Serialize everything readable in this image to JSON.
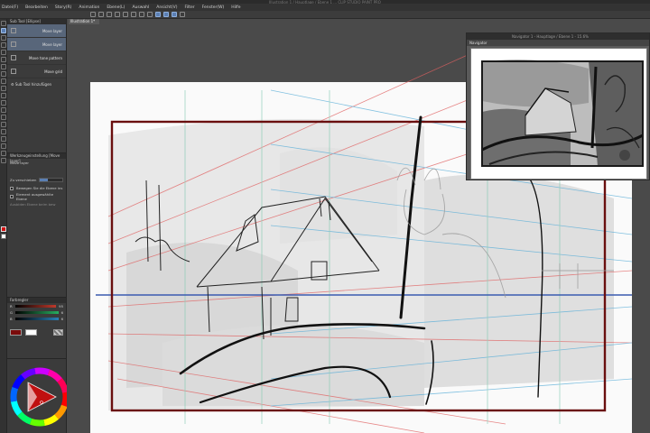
{
  "window": {
    "title": "Illustration 1 / Hauptlage / Ebene 1 ... CLIP STUDIO PAINT PRO"
  },
  "menu": [
    "Datei(F)",
    "Bearbeiten",
    "Story(R)",
    "Animation",
    "Ebene(L)",
    "Auswahl",
    "Ansicht(V)",
    "Filter",
    "Fenster(W)",
    "Hilfe"
  ],
  "document_tab": "Illustration 1*",
  "subtool": {
    "header": "Sub Tool [Ellipse]",
    "items": [
      {
        "label": "Move layer",
        "selected": true
      },
      {
        "label": "Move layer",
        "selected": false
      },
      {
        "label": "Move tone pattern",
        "selected": false
      },
      {
        "label": "Move grid",
        "selected": false
      }
    ],
    "add_label": "Sub Tool hinzufügen"
  },
  "tool_property": {
    "header": "Werkzeugeinstellung [Move layer]",
    "name": "Move layer",
    "rows": [
      {
        "label": "Zu verschieben",
        "value": 0.35
      },
      {
        "label": "Bewegen Sie die Ebene ins",
        "value": null
      },
      {
        "label": "Element ausgewählte Ebene",
        "value": null
      },
      {
        "label": "Ausblden Ebene beim bew",
        "value": null
      }
    ]
  },
  "color_slider": {
    "header": "Farbregler",
    "rows": [
      {
        "label": "R",
        "value": "95",
        "color": "#c0392b"
      },
      {
        "label": "G",
        "value": "6",
        "color": "#27ae60"
      },
      {
        "label": "B",
        "value": "6",
        "color": "#2980b9"
      }
    ],
    "main_color": "#7a0b0b",
    "sub_color": "#ffffff"
  },
  "navigator": {
    "title": "Navigator 1 - Hauptlage / Ebene 1 - 15.6%",
    "tab": "Navigator"
  },
  "colors": {
    "frame": "#6a0f0f",
    "horizon": "#3a5bb0",
    "perspective_red": "#e06060",
    "perspective_blue": "#5aaed8"
  },
  "icons": [
    "pen-icon",
    "eraser-icon",
    "selection-icon",
    "fill-icon",
    "move-icon",
    "text-icon"
  ]
}
